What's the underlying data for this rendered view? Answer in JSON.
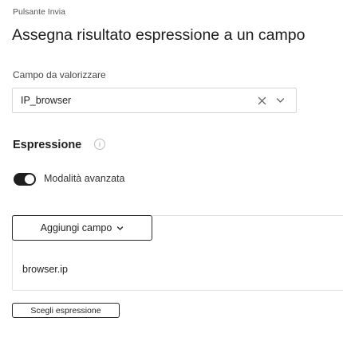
{
  "breadcrumb": "Pulsante Invia",
  "title": "Assegna risultato espressione a un campo",
  "field": {
    "label": "Campo da valorizzare",
    "value": "IP_browser",
    "clear_icon": "close-icon",
    "dropdown_icon": "chevron-down-icon"
  },
  "expression_section": {
    "title": "Espressione",
    "info_icon": "info-icon",
    "info_glyph": "i",
    "advanced_mode": {
      "label": "Modalità avanzata",
      "enabled": true
    },
    "add_field_label": "Aggiungi campo",
    "expression_value": "browser.ip",
    "choose_expression_label": "Scegli espressione"
  },
  "colors": {
    "toggle_on": "#1f1f1f",
    "border": "#d6d6d6",
    "button_border": "#2b2b2b"
  }
}
